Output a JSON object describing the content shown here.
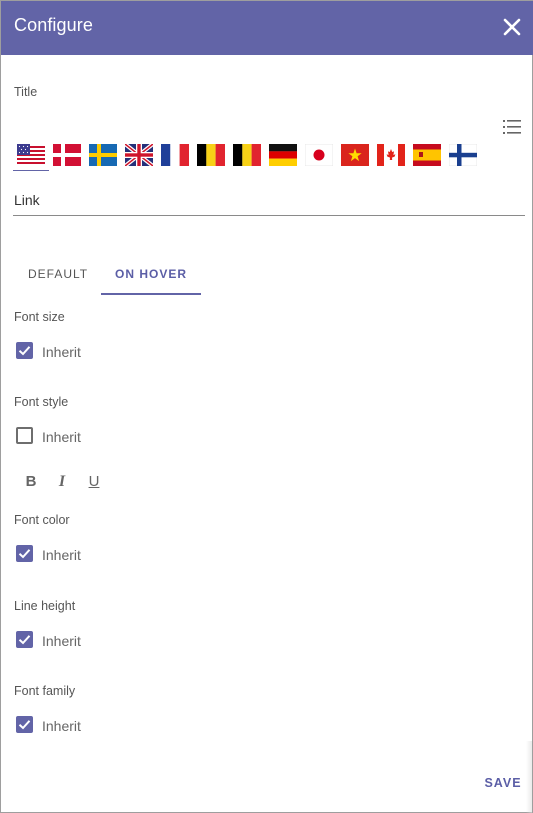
{
  "header": {
    "title": "Configure",
    "close_icon": "close-icon",
    "background": "#6264a7"
  },
  "title_section": {
    "label": "Title",
    "list_icon": "list-icon",
    "flags": [
      "us-flag",
      "denmark-flag",
      "sweden-flag",
      "uk-flag",
      "france-flag",
      "belgium-flag",
      "belgium-flag",
      "germany-flag",
      "japan-flag",
      "vietnam-flag",
      "canada-flag",
      "spain-flag",
      "finland-flag"
    ],
    "selected_flag": "us-flag"
  },
  "link_field": {
    "value": "Link"
  },
  "tabs": [
    {
      "label": "DEFAULT",
      "active": false
    },
    {
      "label": "ON HOVER",
      "active": true
    }
  ],
  "settings": {
    "font_size": {
      "label": "Font size",
      "checkbox_label": "Inherit",
      "checked": true
    },
    "font_style": {
      "label": "Font style",
      "checkbox_label": "Inherit",
      "checked": false
    },
    "format_buttons": {
      "bold": "B",
      "italic": "I",
      "underline": "U"
    },
    "font_color": {
      "label": "Font color",
      "checkbox_label": "Inherit",
      "checked": true
    },
    "line_height": {
      "label": "Line height",
      "checkbox_label": "Inherit",
      "checked": true
    },
    "font_family": {
      "label": "Font family",
      "checkbox_label": "Inherit",
      "checked": true
    }
  },
  "footer": {
    "save_label": "SAVE"
  },
  "colors": {
    "accent": "#6264a7"
  }
}
